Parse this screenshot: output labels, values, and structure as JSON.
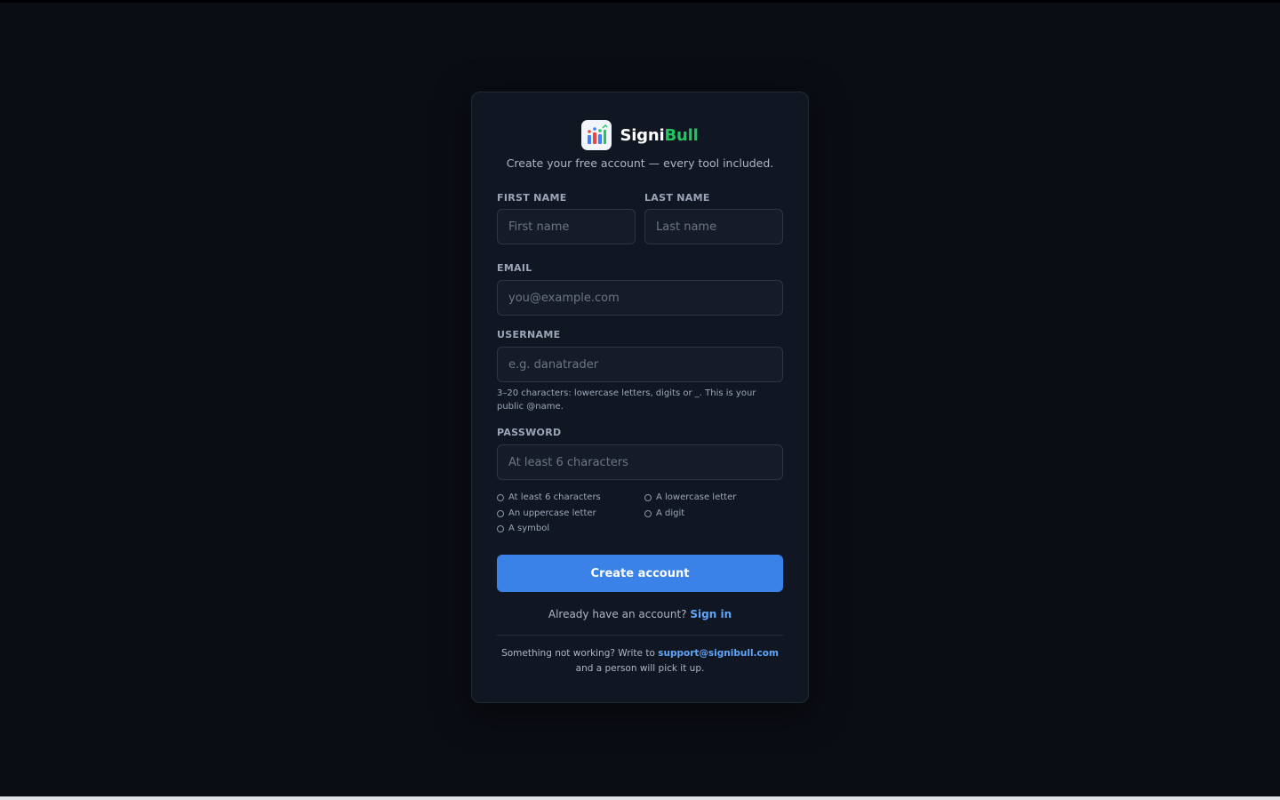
{
  "brand": {
    "name_part1": "Signi",
    "name_part2": "Bull",
    "logo": "bar-chart-logo-icon"
  },
  "subtitle": "Create your free account — every tool included.",
  "form": {
    "first_name": {
      "label": "FIRST NAME",
      "placeholder": "First name",
      "value": ""
    },
    "last_name": {
      "label": "LAST NAME",
      "placeholder": "Last name",
      "value": ""
    },
    "email": {
      "label": "EMAIL",
      "placeholder": "you@example.com",
      "value": ""
    },
    "username": {
      "label": "USERNAME",
      "placeholder": "e.g. danatrader",
      "value": "",
      "hint": "3–20 characters: lowercase letters, digits or _. This is your public @name."
    },
    "password": {
      "label": "PASSWORD",
      "placeholder": "At least 6 characters",
      "value": ""
    },
    "password_rules": [
      "At least 6 characters",
      "A lowercase letter",
      "An uppercase letter",
      "A digit",
      "A symbol"
    ],
    "submit_label": "Create account"
  },
  "signin": {
    "prompt": "Already have an account?",
    "link_label": "Sign in"
  },
  "support": {
    "prefix": "Something not working? Write to",
    "email": "support@signibull.com",
    "suffix": "and a person will pick it up."
  },
  "colors": {
    "background": "#0a0d14",
    "card": "#111722",
    "accent": "#3b82e8",
    "brand_green": "#22c55e",
    "link": "#60a5fa"
  }
}
